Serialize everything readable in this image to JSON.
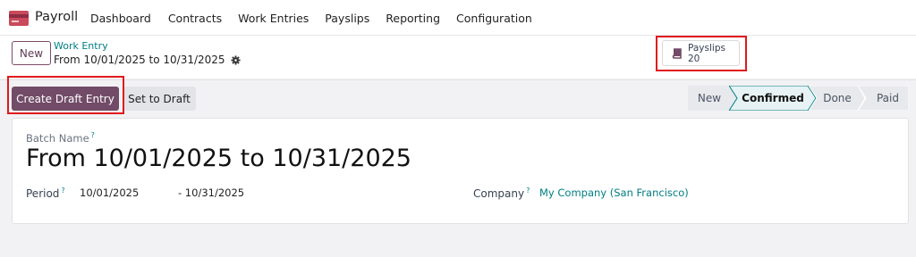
{
  "app": {
    "name": "Payroll",
    "menu": [
      "Dashboard",
      "Contracts",
      "Work Entries",
      "Payslips",
      "Reporting",
      "Configuration"
    ]
  },
  "control": {
    "new_label": "New",
    "breadcrumb_parent": "Work Entry",
    "breadcrumb_current": "From 10/01/2025 to 10/31/2025",
    "smart_button": {
      "label": "Payslips",
      "value": "20",
      "icon": "book-icon"
    }
  },
  "actions": {
    "primary": "Create Draft Entry",
    "secondary": "Set to Draft"
  },
  "stages": [
    {
      "label": "New",
      "active": false
    },
    {
      "label": "Confirmed",
      "active": true
    },
    {
      "label": "Done",
      "active": false
    },
    {
      "label": "Paid",
      "active": false
    }
  ],
  "form": {
    "batch_name_label": "Batch Name",
    "help_mark": "?",
    "batch_name": "From 10/01/2025 to 10/31/2025",
    "period_label": "Period",
    "period_start": "10/01/2025",
    "period_end": "- 10/31/2025",
    "company_label": "Company",
    "company_value": "My Company (San Francisco)"
  },
  "colors": {
    "brand": "#714b67",
    "link": "#017e84",
    "highlight": "#e0191d"
  }
}
